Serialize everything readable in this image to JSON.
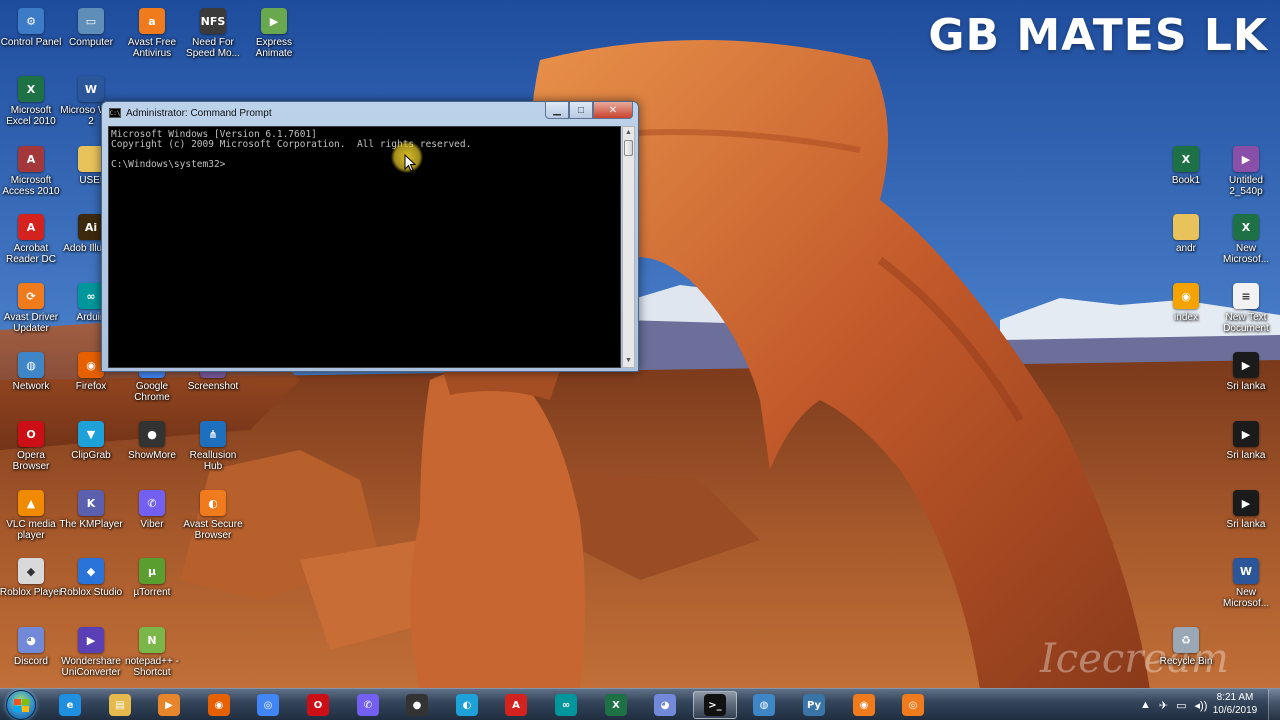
{
  "watermark": {
    "brand_text": "GB MATES LK",
    "icecream_text": "Icecream"
  },
  "cmd": {
    "title": "Administrator: Command Prompt",
    "lines": [
      "Microsoft Windows [Version 6.1.7601]",
      "Copyright (c) 2009 Microsoft Corporation.  All rights reserved.",
      "",
      "C:\\Windows\\system32>"
    ],
    "minimize_glyph": "▁",
    "maximize_glyph": "□",
    "close_glyph": "✕",
    "scroll_up_glyph": "▲",
    "scroll_down_glyph": "▼"
  },
  "desktop_icons": [
    {
      "label": "Control Panel",
      "icon": "control-panel-icon",
      "glyph": "⚙",
      "color": "#3b7bc8"
    },
    {
      "label": "Computer",
      "icon": "computer-icon",
      "glyph": "▭",
      "color": "#5f8fb8"
    },
    {
      "label": "Avast Free Antivirus",
      "icon": "avast-icon",
      "glyph": "a",
      "color": "#f07b1d"
    },
    {
      "label": "Need For Speed Mo...",
      "icon": "game-icon",
      "glyph": "NFS",
      "color": "#3a3a3a"
    },
    {
      "label": "Express Animate",
      "icon": "express-animate-icon",
      "glyph": "▶",
      "color": "#6aa84f"
    },
    {
      "label": "Microsoft Excel 2010",
      "icon": "excel-icon",
      "glyph": "X",
      "color": "#1e7145"
    },
    {
      "label": "Microso Word 2",
      "icon": "word-icon",
      "glyph": "W",
      "color": "#2b579a"
    },
    {
      "label": "Microsoft Access 2010",
      "icon": "access-icon",
      "glyph": "A",
      "color": "#a4373a"
    },
    {
      "label": "USEI",
      "icon": "folder-icon",
      "glyph": "",
      "color": "#e8c25a"
    },
    {
      "label": "Acrobat Reader DC",
      "icon": "acrobat-icon",
      "glyph": "A",
      "color": "#d4231f"
    },
    {
      "label": "Adob Illustra",
      "icon": "illustrator-icon",
      "glyph": "Ai",
      "color": "#3d2a0e"
    },
    {
      "label": "Avast Driver Updater",
      "icon": "avast-driver-icon",
      "glyph": "⟳",
      "color": "#f07b1d"
    },
    {
      "label": "Arduin",
      "icon": "arduino-icon",
      "glyph": "∞",
      "color": "#00979c"
    },
    {
      "label": "Network",
      "icon": "network-icon",
      "glyph": "◍",
      "color": "#3f86c6"
    },
    {
      "label": "Firefox",
      "icon": "firefox-icon",
      "glyph": "◉",
      "color": "#e66000"
    },
    {
      "label": "Google Chrome",
      "icon": "chrome-icon",
      "glyph": "◎",
      "color": "#4285f4"
    },
    {
      "label": "Screenshot",
      "icon": "screenshot-icon",
      "glyph": "✂",
      "color": "#7a5aa0"
    },
    {
      "label": "Opera Browser",
      "icon": "opera-icon",
      "glyph": "O",
      "color": "#cc0f16"
    },
    {
      "label": "ClipGrab",
      "icon": "clipgrab-icon",
      "glyph": "▼",
      "color": "#1ea1d9"
    },
    {
      "label": "ShowMore",
      "icon": "showmore-icon",
      "glyph": "●",
      "color": "#333333"
    },
    {
      "label": "Reallusion Hub",
      "icon": "reallusion-icon",
      "glyph": "⋔",
      "color": "#1f6fbf"
    },
    {
      "label": "VLC media player",
      "icon": "vlc-icon",
      "glyph": "▲",
      "color": "#f08a00"
    },
    {
      "label": "The KMPlayer",
      "icon": "kmplayer-icon",
      "glyph": "K",
      "color": "#5a5fae"
    },
    {
      "label": "Viber",
      "icon": "viber-icon",
      "glyph": "✆",
      "color": "#7360f2"
    },
    {
      "label": "Avast Secure Browser",
      "icon": "avast-browser-icon",
      "glyph": "◐",
      "color": "#f07b1d"
    },
    {
      "label": "Roblox Player",
      "icon": "roblox-icon",
      "glyph": "◆",
      "color": "#d9d9d9"
    },
    {
      "label": "Roblox Studio",
      "icon": "roblox-studio-icon",
      "glyph": "◆",
      "color": "#2a73d8"
    },
    {
      "label": "µTorrent",
      "icon": "utorrent-icon",
      "glyph": "µ",
      "color": "#5a9e2f"
    },
    {
      "label": "Discord",
      "icon": "discord-icon",
      "glyph": "◕",
      "color": "#7289da"
    },
    {
      "label": "Wondershare UniConverter",
      "icon": "uniconverter-icon",
      "glyph": "▶",
      "color": "#5b3fb5"
    },
    {
      "label": "notepad++ - Shortcut",
      "icon": "notepadpp-icon",
      "glyph": "N",
      "color": "#7ab648"
    },
    {
      "label": "Book1",
      "icon": "excel-file-icon",
      "glyph": "X",
      "color": "#1e7145"
    },
    {
      "label": "Untitled 2_540p",
      "icon": "video-file-icon",
      "glyph": "▶",
      "color": "#8a4fa8"
    },
    {
      "label": "andr",
      "icon": "folder-icon",
      "glyph": "",
      "color": "#e8c25a"
    },
    {
      "label": "New Microsof...",
      "icon": "excel-file-icon",
      "glyph": "X",
      "color": "#1e7145"
    },
    {
      "label": "index",
      "icon": "html-file-icon",
      "glyph": "◉",
      "color": "#f4a300"
    },
    {
      "label": "New Text Document",
      "icon": "text-file-icon",
      "glyph": "≡",
      "color": "#f2f2f2"
    },
    {
      "label": "Sri lanka",
      "icon": "video-file-icon",
      "glyph": "▶",
      "color": "#1b1b1b"
    },
    {
      "label": "Sri lanka",
      "icon": "video-file-icon",
      "glyph": "▶",
      "color": "#1b1b1b"
    },
    {
      "label": "Sri lanka",
      "icon": "video-file-icon",
      "glyph": "▶",
      "color": "#1b1b1b"
    },
    {
      "label": "New Microsof...",
      "icon": "word-file-icon",
      "glyph": "W",
      "color": "#2b579a"
    },
    {
      "label": "Recycle Bin",
      "icon": "recycle-bin-icon",
      "glyph": "♻",
      "color": "#9aa7b4"
    }
  ],
  "taskbar": {
    "apps": [
      {
        "icon": "internet-explorer-icon",
        "glyph": "e",
        "color": "#1f8fe0",
        "active": false
      },
      {
        "icon": "file-explorer-icon",
        "glyph": "▤",
        "color": "#e6b94d",
        "active": false
      },
      {
        "icon": "media-player-icon",
        "glyph": "▶",
        "color": "#e7852a",
        "active": false
      },
      {
        "icon": "firefox-icon",
        "glyph": "◉",
        "color": "#e66000",
        "active": false
      },
      {
        "icon": "chrome-icon",
        "glyph": "◎",
        "color": "#4285f4",
        "active": false
      },
      {
        "icon": "opera-icon",
        "glyph": "O",
        "color": "#cc0f16",
        "active": false
      },
      {
        "icon": "viber-icon",
        "glyph": "✆",
        "color": "#7360f2",
        "active": false
      },
      {
        "icon": "showmore-icon",
        "glyph": "●",
        "color": "#333333",
        "active": false
      },
      {
        "icon": "clipgrab-icon",
        "glyph": "◐",
        "color": "#1ea1d9",
        "active": false
      },
      {
        "icon": "acrobat-icon",
        "glyph": "A",
        "color": "#d4231f",
        "active": false
      },
      {
        "icon": "arduino-icon",
        "glyph": "∞",
        "color": "#00979c",
        "active": false
      },
      {
        "icon": "excel-icon",
        "glyph": "X",
        "color": "#1e7145",
        "active": false
      },
      {
        "icon": "discord-icon",
        "glyph": "◕",
        "color": "#7289da",
        "active": false
      },
      {
        "icon": "command-prompt-icon",
        "glyph": ">_",
        "color": "#111111",
        "active": true
      },
      {
        "icon": "network-globe-icon",
        "glyph": "◍",
        "color": "#3f86c6",
        "active": false
      },
      {
        "icon": "python-icon",
        "glyph": "Py",
        "color": "#3a75a8",
        "active": false
      },
      {
        "icon": "recorder-icon",
        "glyph": "◉",
        "color": "#f07b1d",
        "active": false
      },
      {
        "icon": "screenshot-icon",
        "glyph": "◎",
        "color": "#f07b1d",
        "active": false
      }
    ],
    "tray_glyphs": [
      "▲",
      "✈",
      "▭",
      "◂))"
    ],
    "time": "8:21 AM",
    "date": "10/6/2019"
  },
  "colors": {
    "sky_top": "#2d58a6",
    "sky_bottom": "#5c8fd0",
    "rock": "#c8642a",
    "desert": "#8a4a25"
  }
}
